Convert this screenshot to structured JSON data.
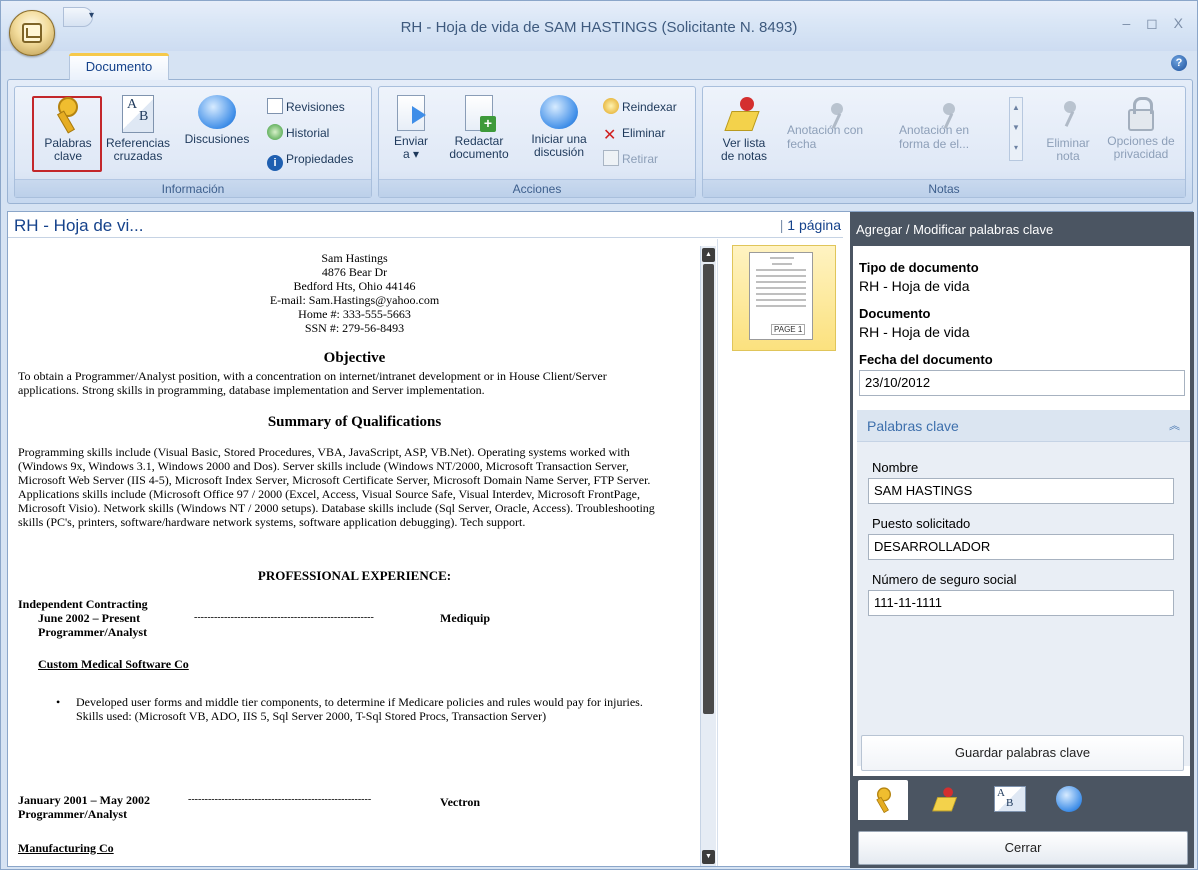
{
  "window": {
    "title": "RH - Hoja de vida de SAM HASTINGS (Solicitante N. 8493)",
    "controls": "– ◻ X"
  },
  "ribbon": {
    "tab": "Documento",
    "groups": {
      "informacion": {
        "label": "Información",
        "palabras_clave": [
          "Palabras",
          "clave"
        ],
        "referencias": [
          "Referencias",
          "cruzadas"
        ],
        "discusiones": "Discusiones",
        "revisiones": "Revisiones",
        "historial": "Historial",
        "propiedades": "Propiedades"
      },
      "acciones": {
        "label": "Acciones",
        "enviar": [
          "Enviar",
          "a ▾"
        ],
        "redactar": [
          "Redactar",
          "documento"
        ],
        "iniciar": [
          "Iniciar una",
          "discusión"
        ],
        "reindexar": "Reindexar",
        "eliminar": "Eliminar",
        "retirar": "Retirar"
      },
      "notas": {
        "label": "Notas",
        "ver_lista": [
          "Ver lista",
          "de notas"
        ],
        "anotacion_fecha": [
          "Anotación con",
          "fecha"
        ],
        "anotacion_forma": [
          "Anotación en",
          "forma de el..."
        ],
        "eliminar_nota": [
          "Eliminar",
          "nota"
        ],
        "opciones_privacidad": [
          "Opciones de",
          "privacidad"
        ]
      }
    }
  },
  "document": {
    "title": "RH - Hoja de vi...",
    "page_count": "1 página",
    "thumbnail_label": "PAGE 1",
    "header_lines": [
      "Sam Hastings",
      "4876 Bear Dr",
      "Bedford Hts, Ohio 44146",
      "E-mail: Sam.Hastings@yahoo.com",
      "Home #: 333-555-5663",
      "SSN #: 279-56-8493"
    ],
    "objective_heading": "Objective",
    "objective_text": "To obtain a Programmer/Analyst position, with a concentration on internet/intranet development or in House Client/Server applications. Strong skills in programming, database implementation and Server implementation.",
    "summary_heading": "Summary of Qualifications",
    "summary_text": "Programming skills include (Visual Basic, Stored Procedures, VBA, JavaScript, ASP, VB.Net). Operating systems worked with (Windows 9x, Windows 3.1, Windows 2000 and Dos). Server skills include (Windows NT/2000, Microsoft Transaction Server, Microsoft Web Server (IIS 4-5), Microsoft Index Server, Microsoft Certificate Server, Microsoft Domain Name Server, FTP Server. Applications skills include (Microsoft Office 97 / 2000 (Excel, Access, Visual Source Safe, Visual Interdev, Microsoft FrontPage, Microsoft Visio). Network skills (Windows NT / 2000 setups). Database skills include (Sql Server, Oracle, Access). Troubleshooting skills (PC's, printers, software/hardware network systems, software application debugging). Tech support.",
    "experience_heading": "PROFESSIONAL EXPERIENCE:",
    "job1_company": "Independent Contracting",
    "job1_dates": "June 2002 – Present",
    "job1_dashes": "------------------------------------------------------",
    "job1_client": "Mediquip",
    "job1_role": "Programmer/Analyst",
    "job1_employer": "Custom Medical Software Co",
    "job1_bullet": "Developed user forms and middle tier components, to determine if Medicare policies and rules would pay for injuries. Skills used: (Microsoft VB, ADO,  IIS 5, Sql Server 2000, T-Sql Stored Procs, Transaction Server)",
    "job2_dates": "January 2001 – May 2002",
    "job2_dashes": "-------------------------------------------------------",
    "job2_client": "Vectron",
    "job2_role": "Programmer/Analyst",
    "job2_employer": "Manufacturing Co"
  },
  "panel": {
    "header": "Agregar / Modificar palabras clave",
    "tipo_label": "Tipo de documento",
    "tipo_value": "RH - Hoja de vida",
    "documento_label": "Documento",
    "documento_value": "RH - Hoja de vida",
    "fecha_label": "Fecha del documento",
    "fecha_value": "23/10/2012",
    "keywords_header": "Palabras clave",
    "nombre_label": "Nombre",
    "nombre_value": "SAM HASTINGS",
    "puesto_label": "Puesto solicitado",
    "puesto_value": "DESARROLLADOR",
    "ssn_label": "Número de seguro social",
    "ssn_value": "111-11-1111",
    "save_button": "Guardar palabras clave",
    "close_button": "Cerrar"
  },
  "icons": {
    "tabs": [
      "keys-icon",
      "notes-icon",
      "cross-reference-icon",
      "discussion-icon"
    ]
  },
  "colors": {
    "selection_border": "#c3272b",
    "panel_background": "#4b5562",
    "accent_text": "#15428b"
  }
}
